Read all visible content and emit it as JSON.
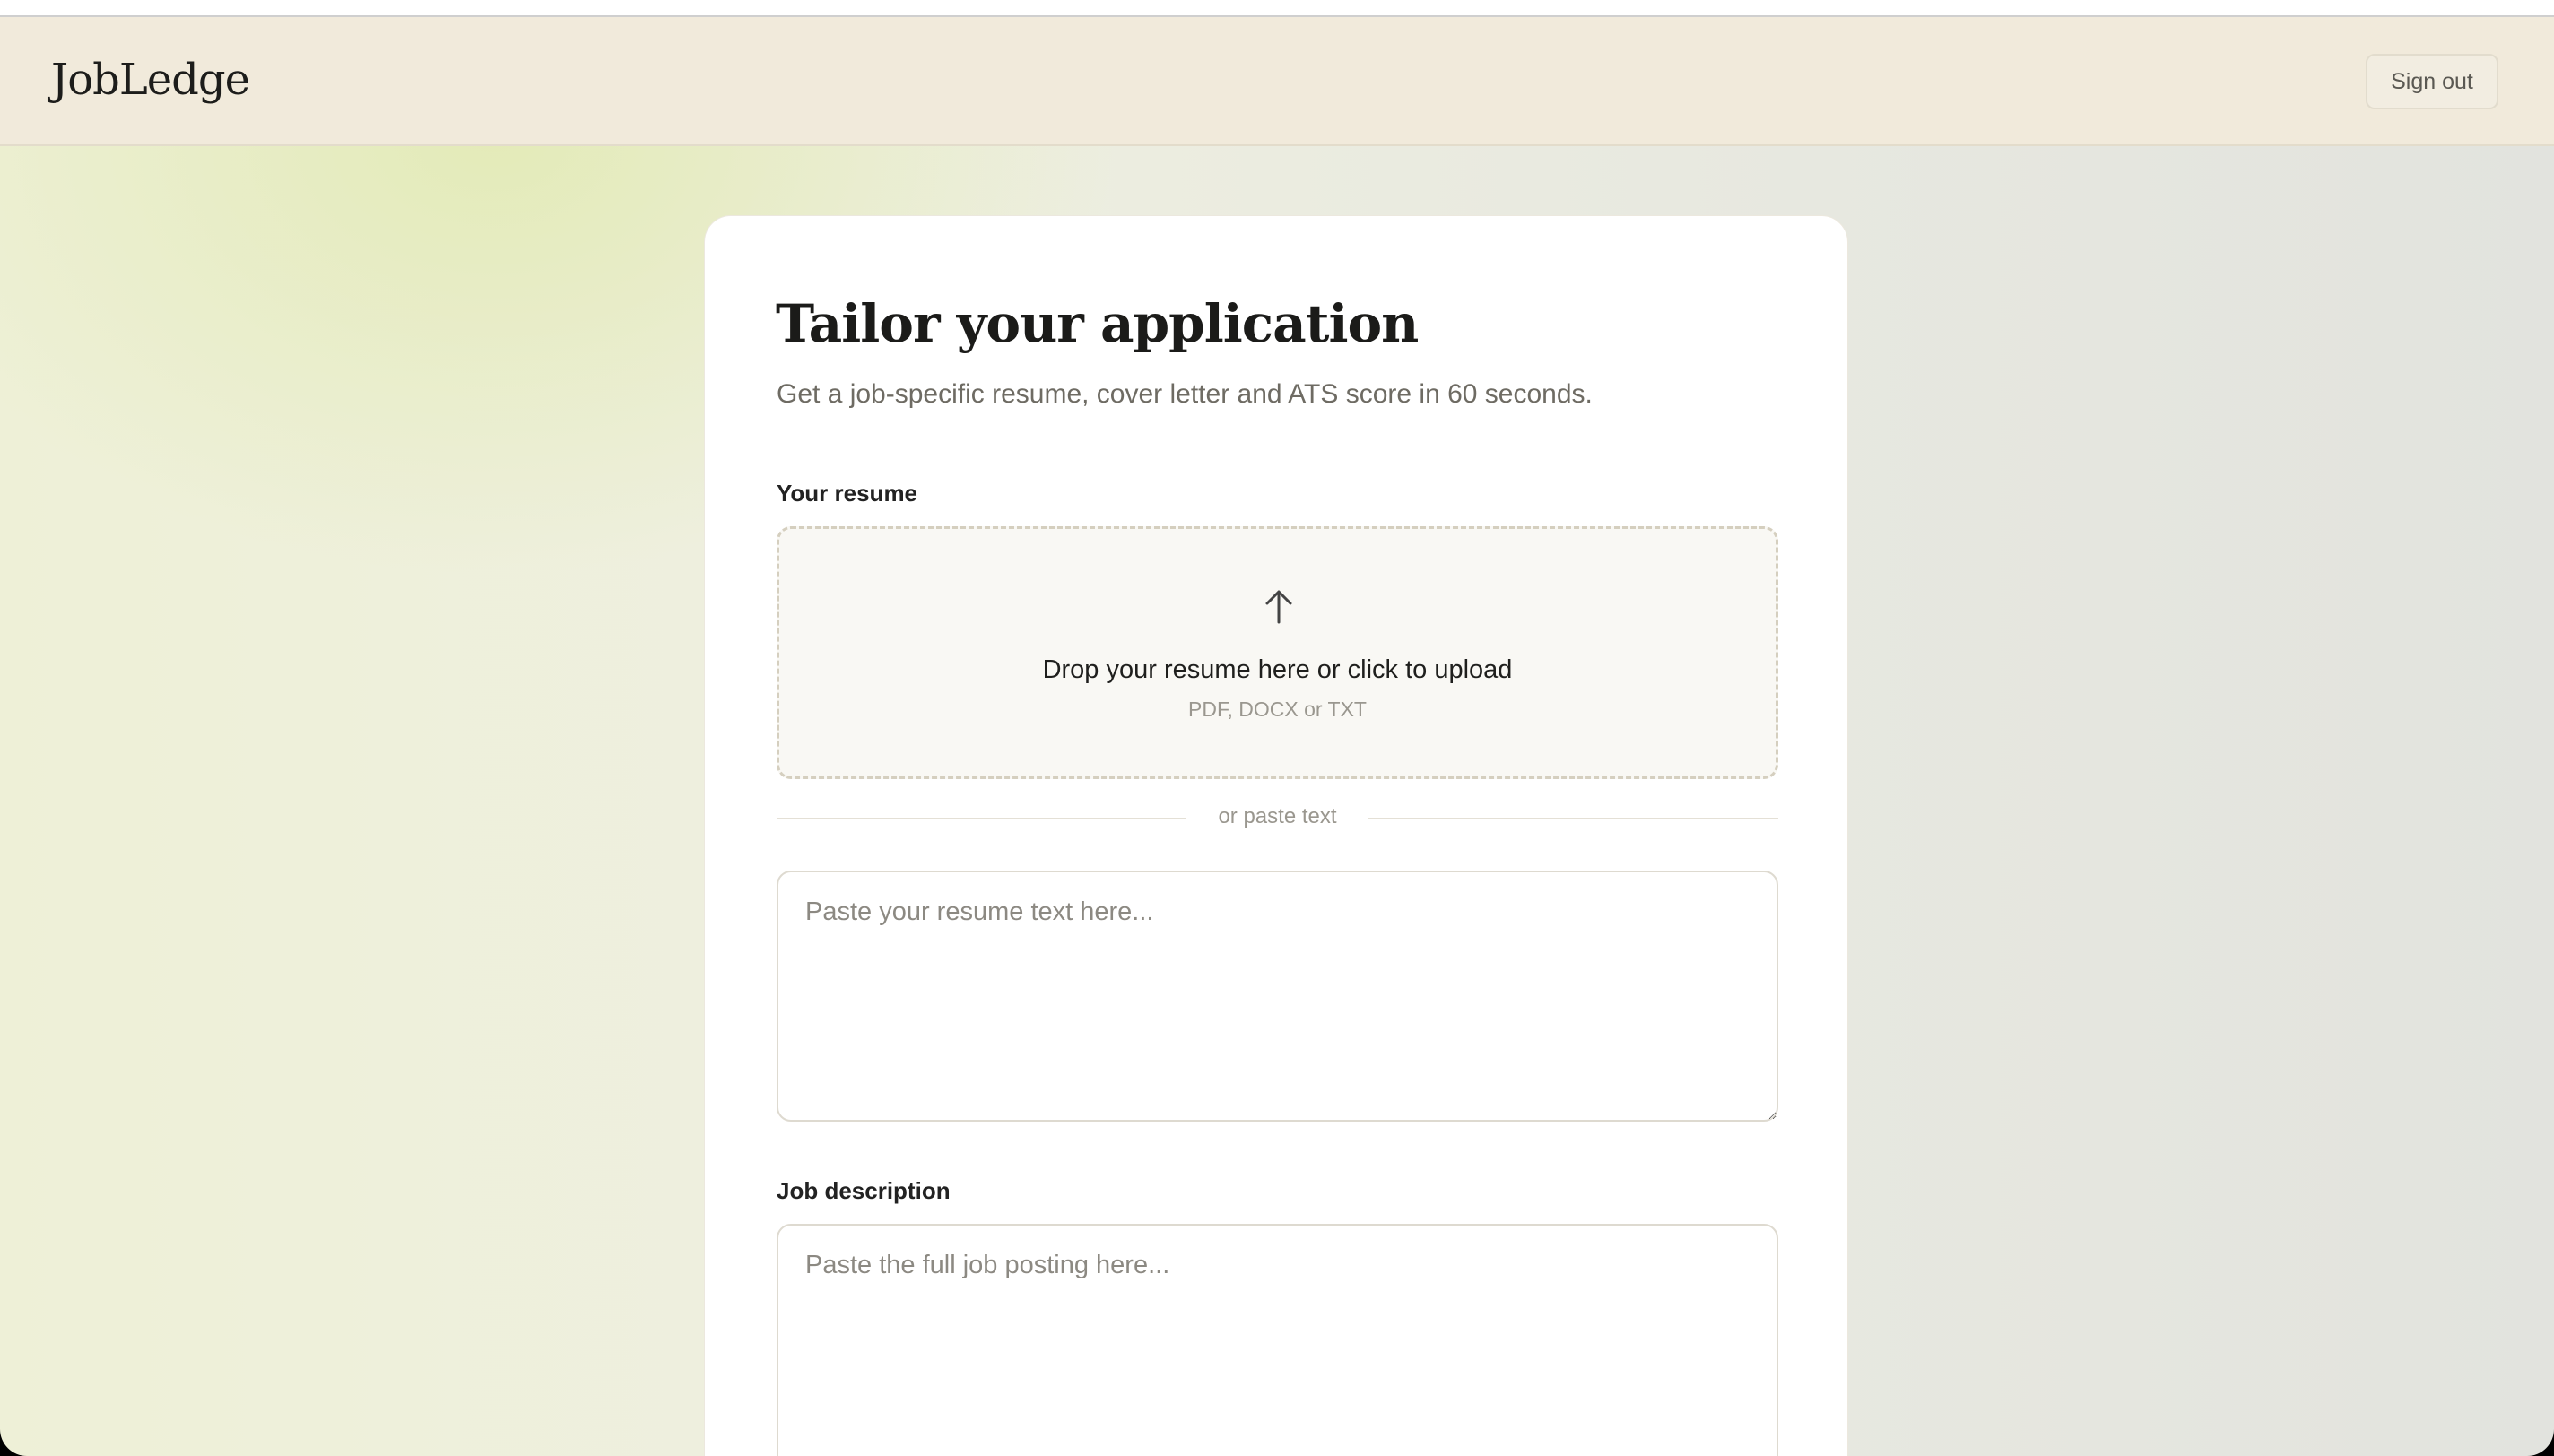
{
  "app": {
    "name": "JobLedge",
    "signout_label": "Sign out"
  },
  "form": {
    "title": "Tailor your application",
    "subtitle": "Get a job-specific resume, cover letter and ATS score in 60 seconds.",
    "resume_label": "Your resume",
    "upload": {
      "icon": "arrow-up-icon",
      "text": "Drop your resume here or click to upload",
      "hint": "PDF, DOCX or TXT"
    },
    "divider_text": "or paste text",
    "resume_placeholder": "Paste your resume text here...",
    "jd_label": "Job description",
    "jd_placeholder": "Paste the full job posting here..."
  }
}
